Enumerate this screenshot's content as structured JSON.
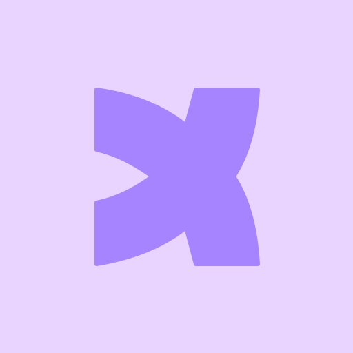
{
  "app_icon": {
    "name": "x-logo-icon",
    "background_color": "#e8d4ff",
    "mark_color": "#a683ff"
  }
}
